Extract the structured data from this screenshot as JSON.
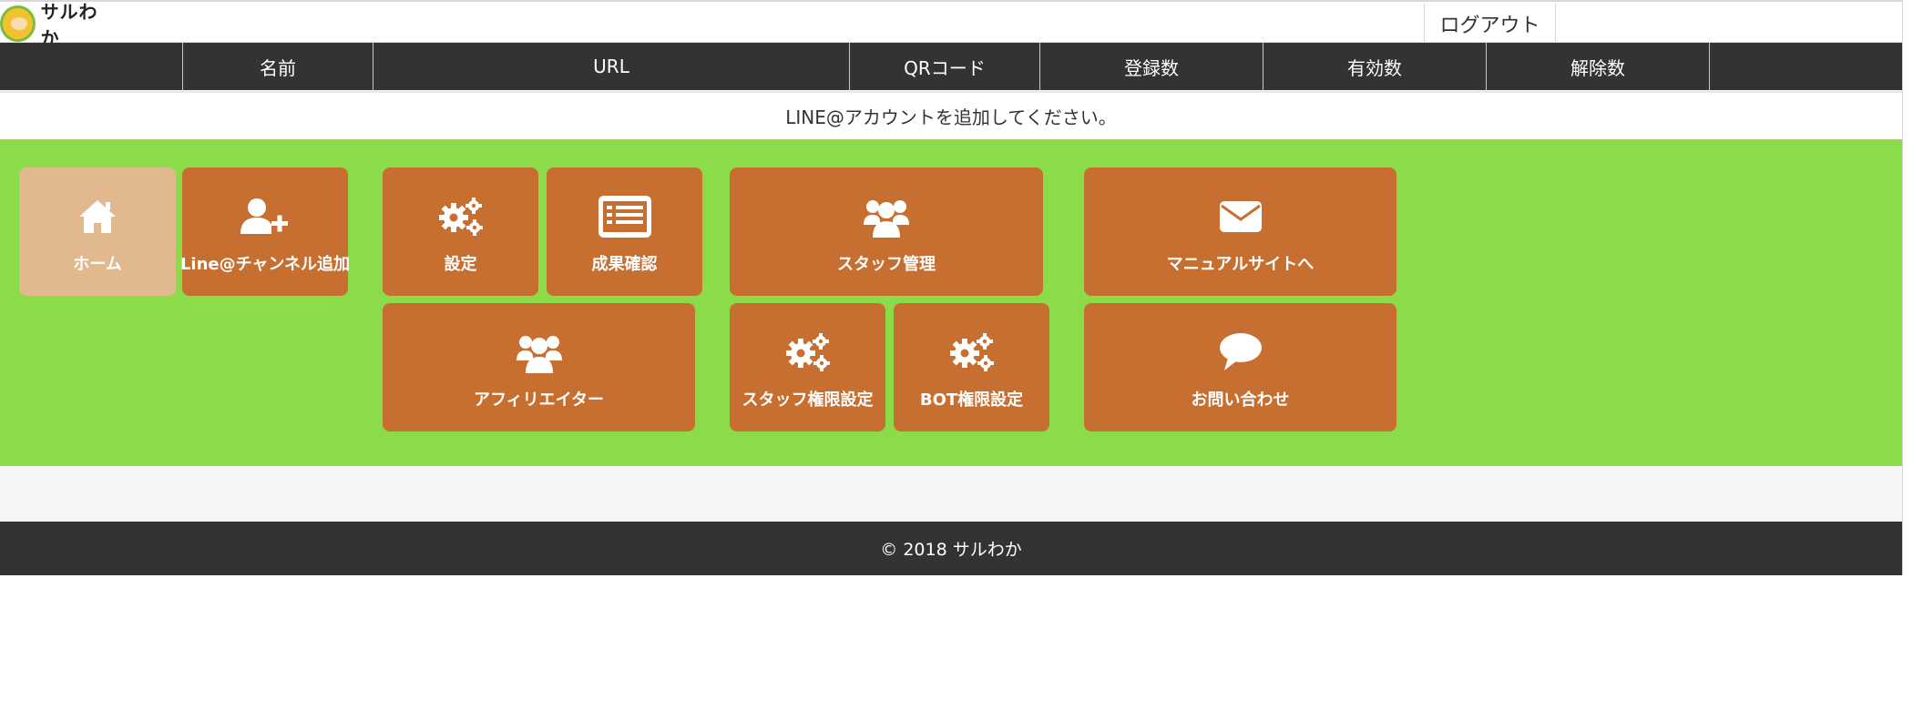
{
  "app": {
    "logo_text": "サルわか",
    "logout_label": "ログアウト"
  },
  "table": {
    "headers": [
      "",
      "名前",
      "URL",
      "QRコード",
      "登録数",
      "有効数",
      "解除数",
      ""
    ],
    "empty_message": "LINE@アカウントを追加してください。"
  },
  "menu": {
    "home": "ホーム",
    "add_channel": "Line@チャンネル追加",
    "settings": "設定",
    "results": "成果確認",
    "staff_management": "スタッフ管理",
    "manual_site": "マニュアルサイトへ",
    "affiliator": "アフィリエイター",
    "staff_permissions": "スタッフ権限設定",
    "bot_permissions": "BOT権限設定",
    "contact": "お問い合わせ"
  },
  "footer": {
    "copyright": "© 2018 サルわか"
  },
  "colors": {
    "tile": "#c76f30",
    "tile_active": "#e2b98f",
    "panel": "#8cdc4a",
    "dark_bar": "#333333"
  }
}
